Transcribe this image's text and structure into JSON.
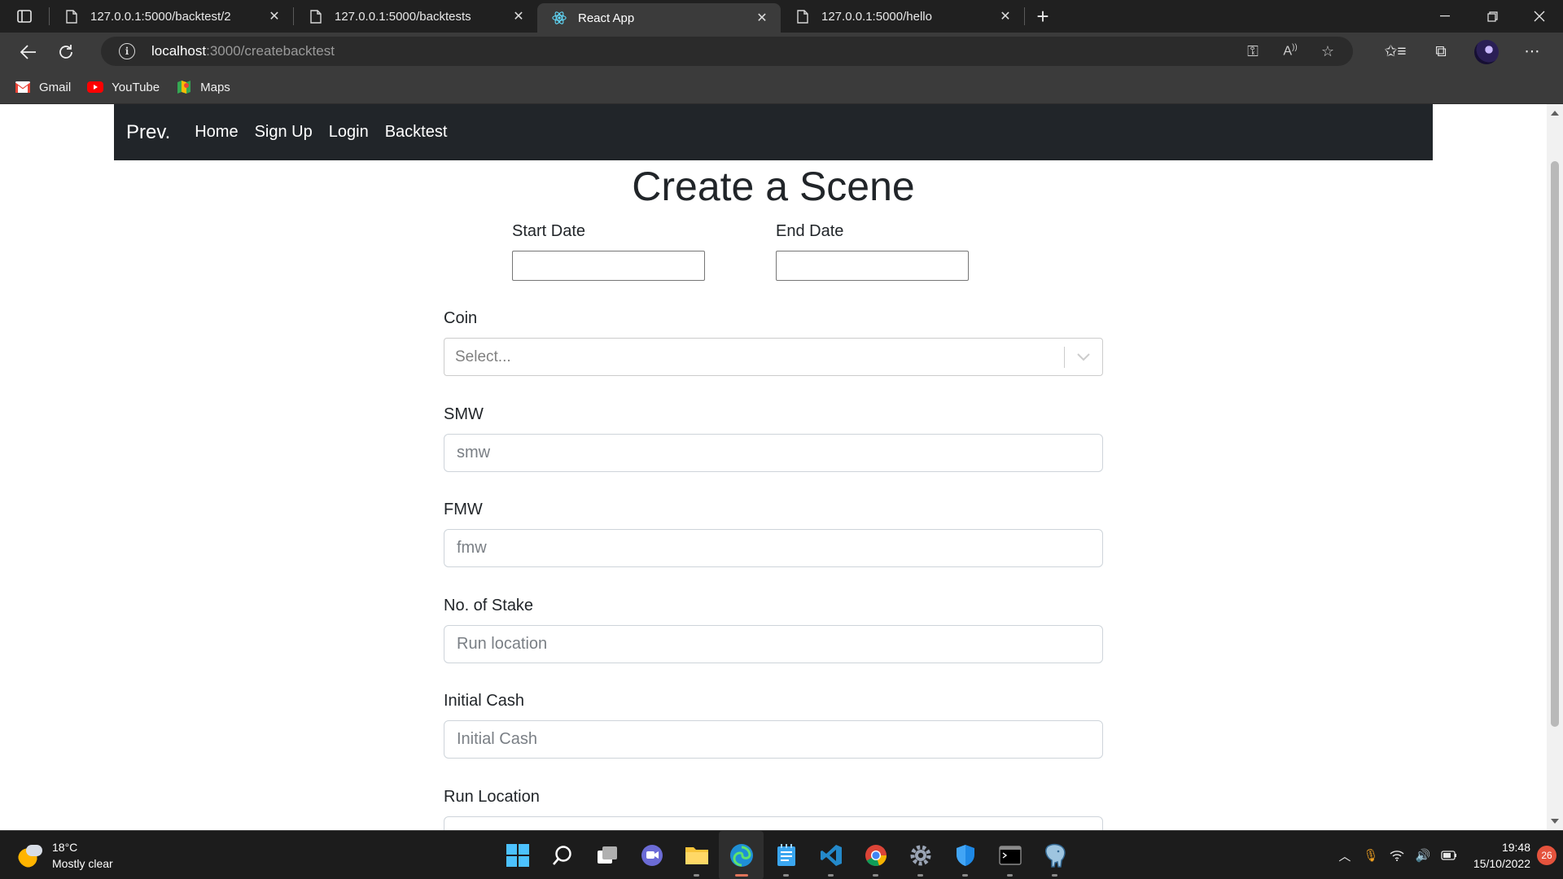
{
  "browser": {
    "tabs": [
      {
        "title": "127.0.0.1:5000/backtest/2",
        "active": false
      },
      {
        "title": "127.0.0.1:5000/backtests",
        "active": false
      },
      {
        "title": "React App",
        "active": true
      },
      {
        "title": "127.0.0.1:5000/hello",
        "active": false
      }
    ],
    "url_host": "localhost",
    "url_path": ":3000/createbacktest",
    "bookmarks": [
      {
        "label": "Gmail",
        "icon": "gmail-icon"
      },
      {
        "label": "YouTube",
        "icon": "youtube-icon"
      },
      {
        "label": "Maps",
        "icon": "maps-icon"
      }
    ]
  },
  "app": {
    "brand": "Prev.",
    "nav": [
      "Home",
      "Sign Up",
      "Login",
      "Backtest"
    ],
    "title": "Create a Scene",
    "form": {
      "start_date_label": "Start Date",
      "end_date_label": "End Date",
      "coin_label": "Coin",
      "coin_placeholder": "Select...",
      "smw_label": "SMW",
      "smw_placeholder": "smw",
      "fmw_label": "FMW",
      "fmw_placeholder": "fmw",
      "stake_label": "No. of Stake",
      "stake_placeholder": "Run location",
      "cash_label": "Initial Cash",
      "cash_placeholder": "Initial Cash",
      "run_location_label": "Run Location"
    }
  },
  "taskbar": {
    "temperature": "18°C",
    "weather": "Mostly clear",
    "time": "19:48",
    "date": "15/10/2022",
    "notifications": "26"
  },
  "colors": {
    "navbar_bg": "#212529",
    "chrome_dark": "#202020",
    "chrome_mid": "#3b3b3b",
    "text": "#212529"
  }
}
